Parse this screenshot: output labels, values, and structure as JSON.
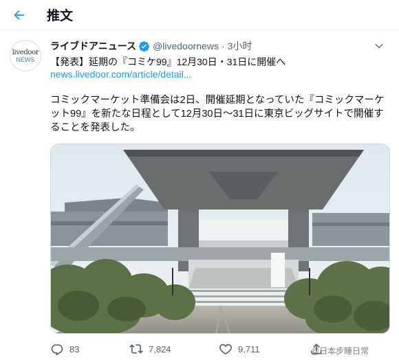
{
  "header": {
    "back_icon": "arrow-left-icon",
    "title": "推文"
  },
  "tweet": {
    "avatar": {
      "line1": "livedoor",
      "line2": "NEWS"
    },
    "author_name": "ライブドアニュース",
    "verified_icon": "verified-badge-icon",
    "handle": "@livedoornews",
    "separator": "·",
    "time": "3小时",
    "more_icon": "chevron-down-icon",
    "headline": "【発表】延期の『コミケ99』12月30日・31日に開催へ",
    "link": "news.livedoor.com/article/detail...",
    "body": "コミックマーケット準備会は2日、開催延期となっていた『コミックマーケット99』を新たな日程として12月30日〜31日に東京ビッグサイトで開催することを発表した。",
    "media_alt": "東京ビッグサイト",
    "actions": {
      "reply": {
        "icon": "reply-icon",
        "count": "83"
      },
      "retweet": {
        "icon": "retweet-icon",
        "count": "7,824"
      },
      "like": {
        "icon": "heart-icon",
        "count": "9,711"
      },
      "share": {
        "icon": "share-icon"
      }
    }
  },
  "watermark": "@日本步睡日常",
  "colors": {
    "accent": "#1d9bf0",
    "text_primary": "#0f1419",
    "text_secondary": "#536471"
  }
}
